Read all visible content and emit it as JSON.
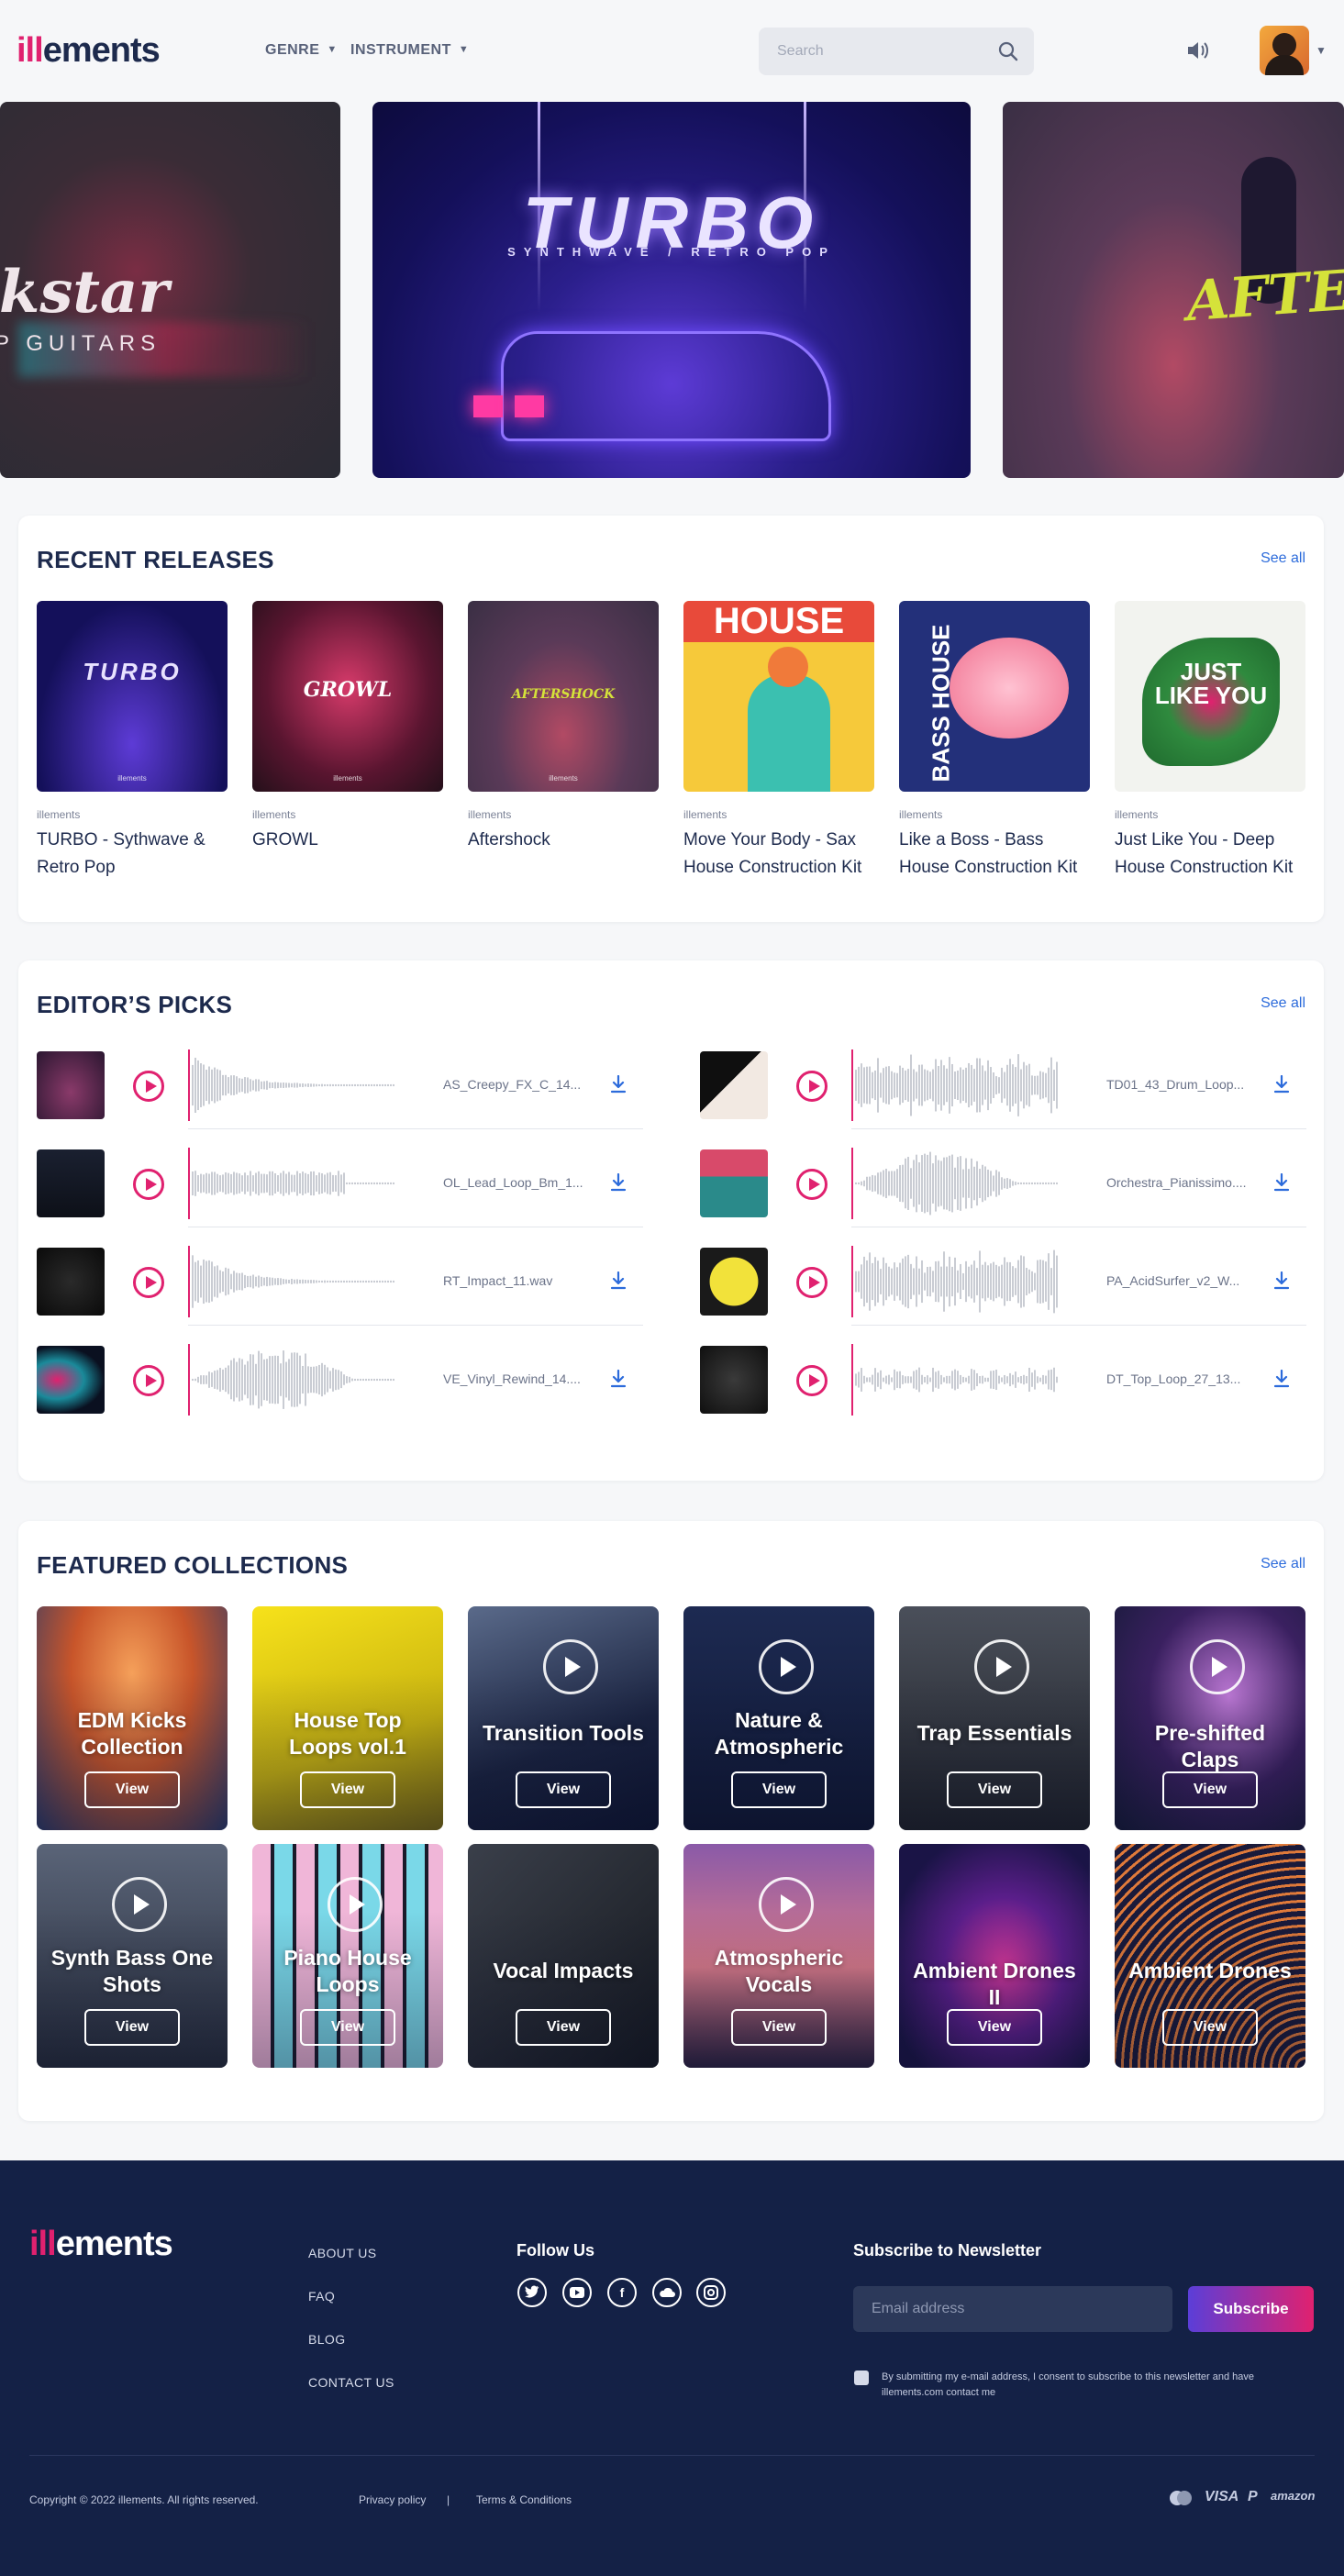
{
  "header": {
    "logo_accent": "ill",
    "logo_rest": "ements",
    "nav": [
      {
        "label": "GENRE"
      },
      {
        "label": "INSTRUMENT"
      }
    ],
    "search_placeholder": "Search"
  },
  "hero": {
    "left_title": "ckstar",
    "left_subtitle": "P GUITARS",
    "center_title": "TURBO",
    "center_subtitle": "SYNTHWAVE / RETRO POP",
    "right_title": "AFTERSHO"
  },
  "recent_releases": {
    "heading": "RECENT RELEASES",
    "see_all": "See all",
    "items": [
      {
        "label": "illements",
        "title": "TURBO - Sythwave & Retro Pop",
        "cover_text": "TURBO"
      },
      {
        "label": "illements",
        "title": "GROWL",
        "cover_text": "GROWL"
      },
      {
        "label": "illements",
        "title": "Aftershock",
        "cover_text": "AFTERSHOCK"
      },
      {
        "label": "illements",
        "title": "Move Your Body - Sax House Construction Kit",
        "cover_text": "HOUSE"
      },
      {
        "label": "illements",
        "title": "Like a Boss - Bass House Construction Kit",
        "cover_text": "BASS HOUSE"
      },
      {
        "label": "illements",
        "title": "Just Like You - Deep House Construction Kit",
        "cover_text": "JUST LIKE YOU"
      }
    ]
  },
  "editors_picks": {
    "heading": "EDITOR’S PICKS",
    "see_all": "See all",
    "items": [
      {
        "file": "AS_Creepy_FX_C_14..."
      },
      {
        "file": "TD01_43_Drum_Loop..."
      },
      {
        "file": "OL_Lead_Loop_Bm_1..."
      },
      {
        "file": "Orchestra_Pianissimo...."
      },
      {
        "file": "RT_Impact_11.wav"
      },
      {
        "file": "PA_AcidSurfer_v2_W..."
      },
      {
        "file": "VE_Vinyl_Rewind_14...."
      },
      {
        "file": "DT_Top_Loop_27_13..."
      }
    ]
  },
  "featured_collections": {
    "heading": "FEATURED COLLECTIONS",
    "see_all": "See all",
    "view_label": "View",
    "items": [
      {
        "title": "EDM Kicks Collection"
      },
      {
        "title": "House Top Loops vol.1"
      },
      {
        "title": "Transition Tools"
      },
      {
        "title": "Nature & Atmospheric"
      },
      {
        "title": "Trap Essentials"
      },
      {
        "title": "Pre-shifted Claps"
      },
      {
        "title": "Synth Bass One Shots"
      },
      {
        "title": "Piano House Loops"
      },
      {
        "title": "Vocal Impacts"
      },
      {
        "title": "Atmospheric Vocals"
      },
      {
        "title": "Ambient Drones II"
      },
      {
        "title": "Ambient Drones"
      }
    ]
  },
  "footer": {
    "links": [
      "ABOUT US",
      "FAQ",
      "BLOG",
      "CONTACT US"
    ],
    "follow_heading": "Follow Us",
    "newsletter_heading": "Subscribe to Newsletter",
    "email_placeholder": "Email address",
    "subscribe_label": "Subscribe",
    "consent": "By submitting my e-mail address, I consent to subscribe to this newsletter and have illements.com contact me",
    "copyright": "Copyright © 2022 illements. All rights reserved.",
    "privacy": "Privacy policy",
    "divider": "|",
    "terms": "Terms & Conditions",
    "payments": [
      "VISA",
      "amazon"
    ]
  },
  "colors": {
    "accent": "#e0216f",
    "navy": "#142146",
    "link": "#2c6bdb"
  }
}
